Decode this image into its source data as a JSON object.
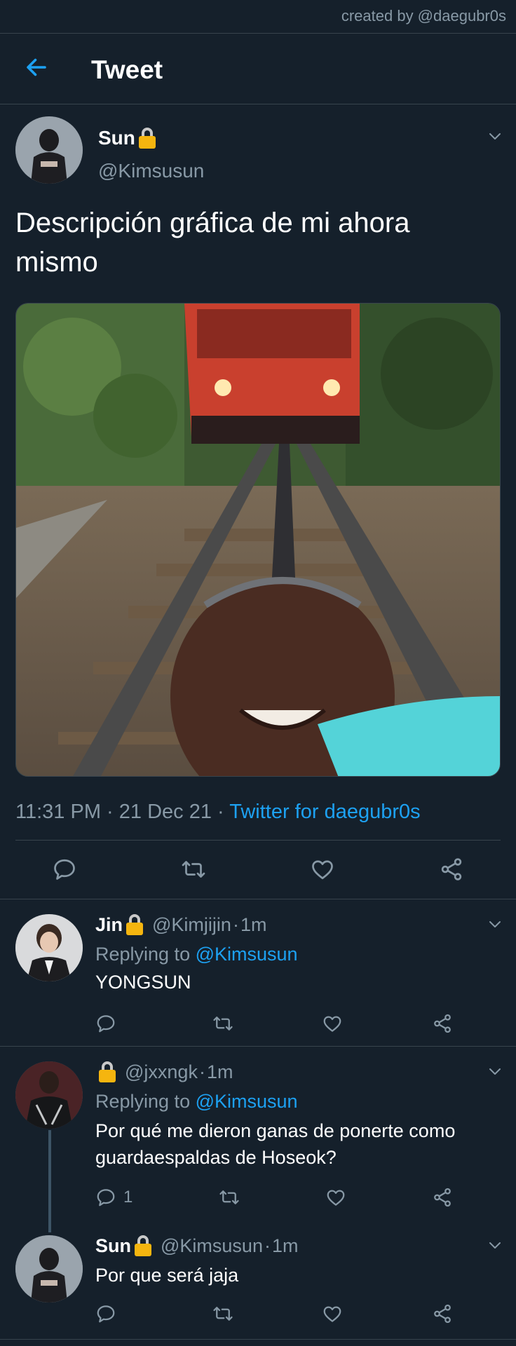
{
  "watermark": "created by @daegubr0s",
  "header": {
    "title": "Tweet"
  },
  "tweet": {
    "name": "Sun",
    "handle": "@Kimsusun",
    "text": "Descripción gráfica de mi ahora mismo",
    "time": "11:31 PM",
    "date": "21 Dec 21",
    "source": "Twitter for daegubr0s"
  },
  "replies": [
    {
      "name": "Jin",
      "handle": "@Kimjijin",
      "age": "1m",
      "replying_label": "Replying to",
      "replying_to": "@Kimsusun",
      "text": "YONGSUN",
      "reply_count": ""
    },
    {
      "name": "",
      "handle": "@jxxngk",
      "age": "1m",
      "replying_label": "Replying to",
      "replying_to": "@Kimsusun",
      "text": "Por qué me dieron ganas de ponerte como guardaespaldas de Hoseok?",
      "reply_count": "1"
    },
    {
      "name": "Sun",
      "handle": "@Kimsusun",
      "age": "1m",
      "text": "Por que será jaja",
      "reply_count": ""
    }
  ],
  "colors": {
    "background": "#15202b",
    "accent": "#1da1f2",
    "muted": "#8899a6",
    "divider": "#38444d"
  },
  "icons": [
    "back-arrow-icon",
    "lock-icon",
    "chevron-down-icon",
    "reply-icon",
    "retweet-icon",
    "like-icon",
    "share-icon"
  ]
}
